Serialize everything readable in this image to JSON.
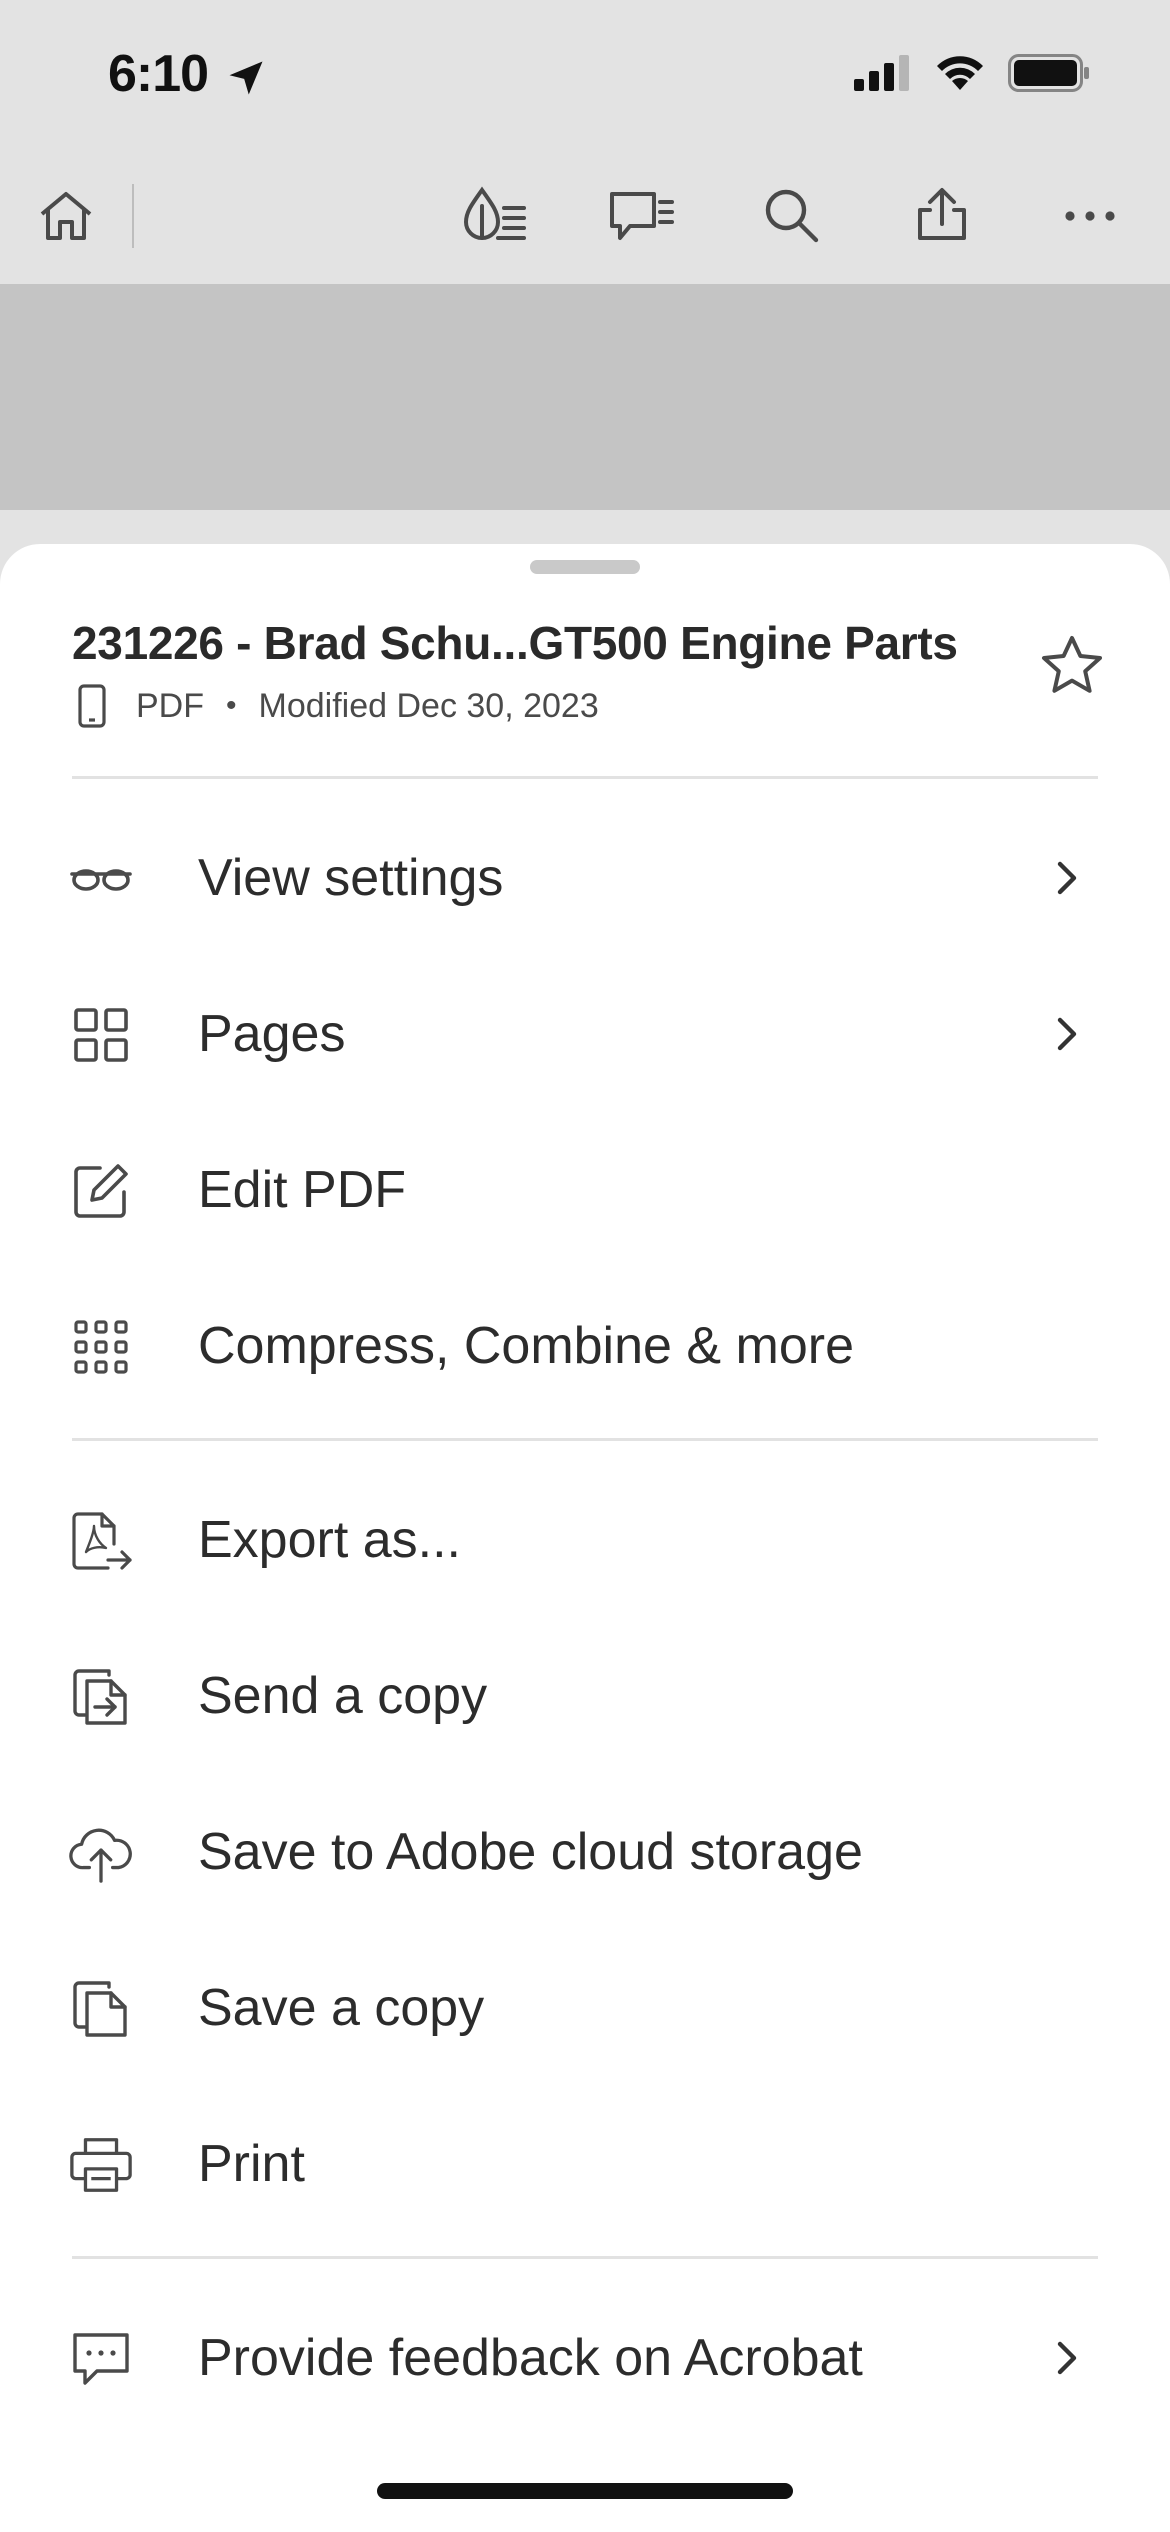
{
  "status_bar": {
    "time": "6:10"
  },
  "toolbar": {
    "icons": [
      "home-icon",
      "reading-mode-icon",
      "comment-icon",
      "search-icon",
      "share-icon",
      "more-icon"
    ]
  },
  "document": {
    "title": "231226 - Brad Schu...GT500 Engine Parts",
    "type": "PDF",
    "separator": "•",
    "modified": "Modified Dec 30, 2023"
  },
  "menu": {
    "group1": [
      {
        "label": "View settings",
        "icon": "glasses-icon",
        "chevron": true
      },
      {
        "label": "Pages",
        "icon": "grid-icon",
        "chevron": true
      },
      {
        "label": "Edit PDF",
        "icon": "edit-icon",
        "chevron": false
      },
      {
        "label": "Compress, Combine & more",
        "icon": "apps-icon",
        "chevron": false
      }
    ],
    "group2": [
      {
        "label": "Export as...",
        "icon": "export-pdf-icon",
        "chevron": false
      },
      {
        "label": "Send a copy",
        "icon": "send-copy-icon",
        "chevron": false
      },
      {
        "label": "Save to Adobe cloud storage",
        "icon": "cloud-upload-icon",
        "chevron": false
      },
      {
        "label": "Save a copy",
        "icon": "copy-icon",
        "chevron": false
      },
      {
        "label": "Print",
        "icon": "printer-icon",
        "chevron": false
      }
    ],
    "group3": [
      {
        "label": "Provide feedback on Acrobat",
        "icon": "feedback-icon",
        "chevron": true
      }
    ]
  },
  "colors": {
    "background": "#e3e3e3",
    "doc_area": "#c4c4c4",
    "sheet": "#ffffff",
    "text": "#2c2c2c",
    "icon": "#4a4a4a"
  }
}
